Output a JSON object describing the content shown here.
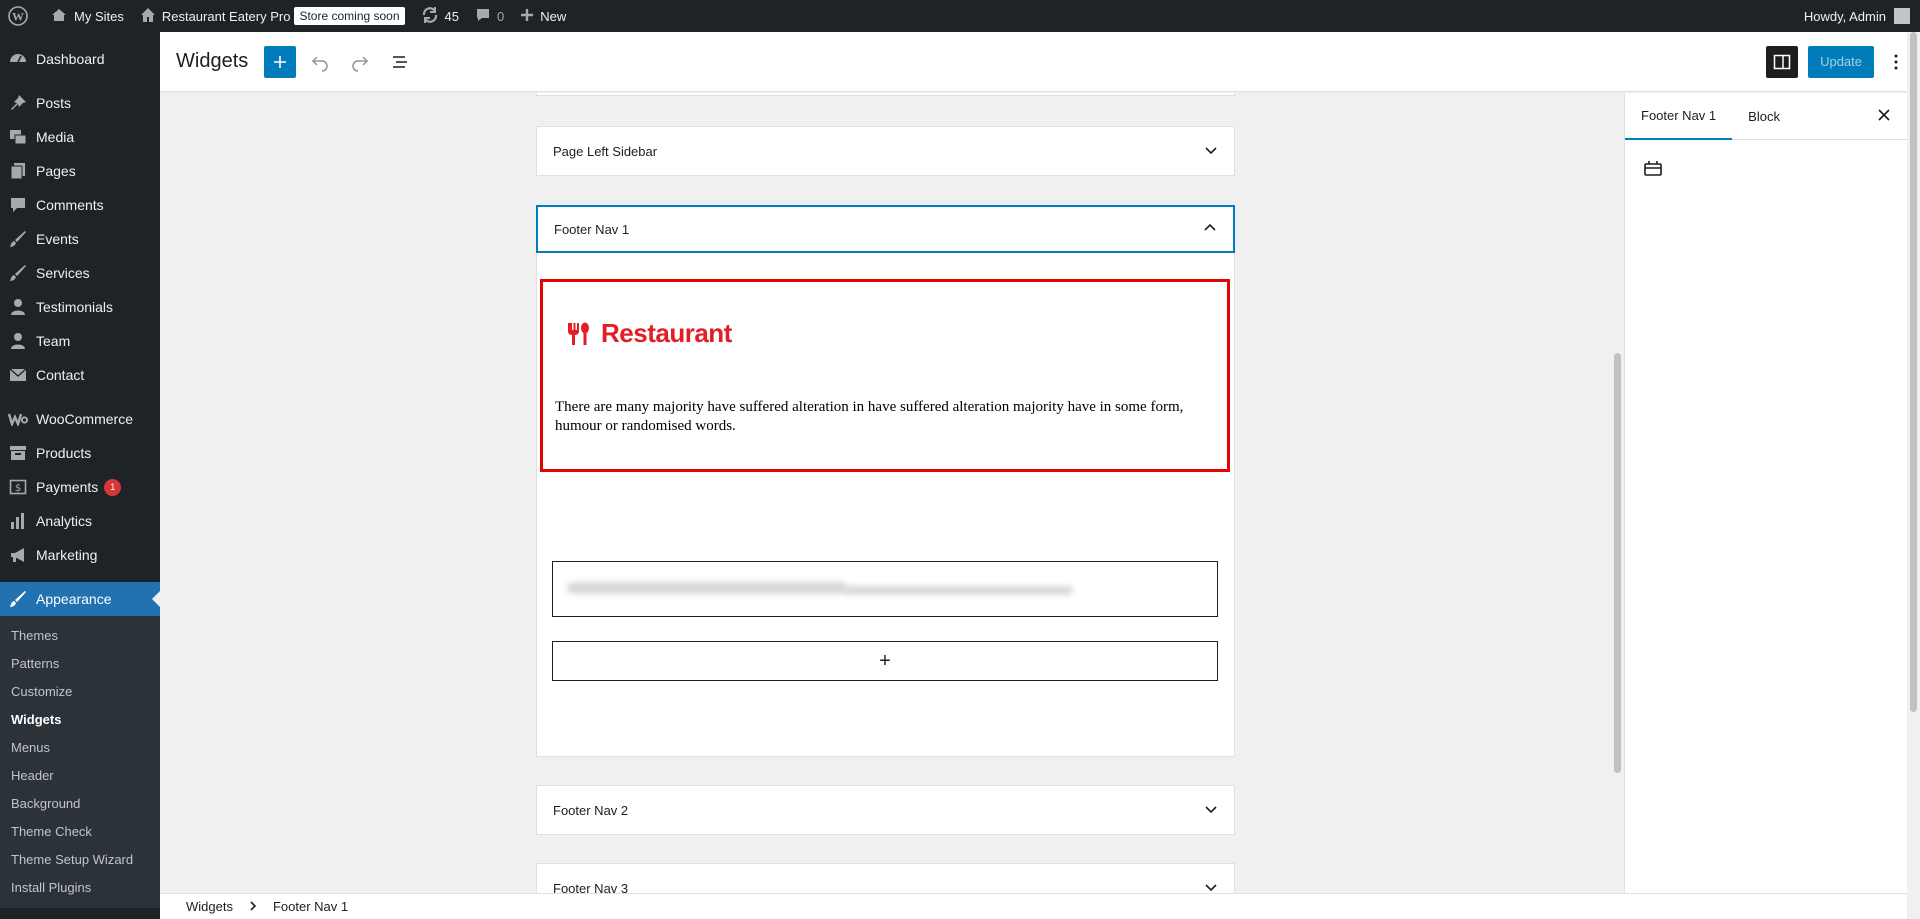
{
  "adminbar": {
    "my_sites": "My Sites",
    "site_name": "Restaurant Eatery Pro",
    "store_badge": "Store coming soon",
    "updates_count": "45",
    "comments_count": "0",
    "new_label": "New",
    "howdy": "Howdy, Admin"
  },
  "sidebar": {
    "dashboard": "Dashboard",
    "posts": "Posts",
    "media": "Media",
    "pages": "Pages",
    "comments": "Comments",
    "events": "Events",
    "services": "Services",
    "testimonials": "Testimonials",
    "team": "Team",
    "contact": "Contact",
    "woocommerce": "WooCommerce",
    "products": "Products",
    "payments": "Payments",
    "payments_badge": "1",
    "analytics": "Analytics",
    "marketing": "Marketing",
    "appearance": "Appearance",
    "submenu": {
      "themes": "Themes",
      "patterns": "Patterns",
      "customize": "Customize",
      "widgets": "Widgets",
      "menus": "Menus",
      "header": "Header",
      "background": "Background",
      "theme_check": "Theme Check",
      "theme_setup_wizard": "Theme Setup Wizard",
      "install_plugins": "Install Plugins"
    }
  },
  "header": {
    "title": "Widgets",
    "update_label": "Update"
  },
  "canvas": {
    "areas": {
      "page_left_sidebar": "Page Left Sidebar",
      "footer_nav_1": "Footer Nav 1",
      "footer_nav_2": "Footer Nav 2",
      "footer_nav_3": "Footer Nav 3"
    },
    "brand_name": "Restaurant",
    "block_text": "There are many majority have suffered alteration in have suffered alteration majority have in some form, humour or randomised words.",
    "appender_symbol": "+"
  },
  "inspector": {
    "tab_area": "Footer Nav 1",
    "tab_block": "Block"
  },
  "breadcrumb": {
    "root": "Widgets",
    "current": "Footer Nav 1"
  },
  "colors": {
    "admin_dark": "#1d2327",
    "accent": "#007cba",
    "brand_red": "#e21e26",
    "selection_red": "#e10600"
  }
}
